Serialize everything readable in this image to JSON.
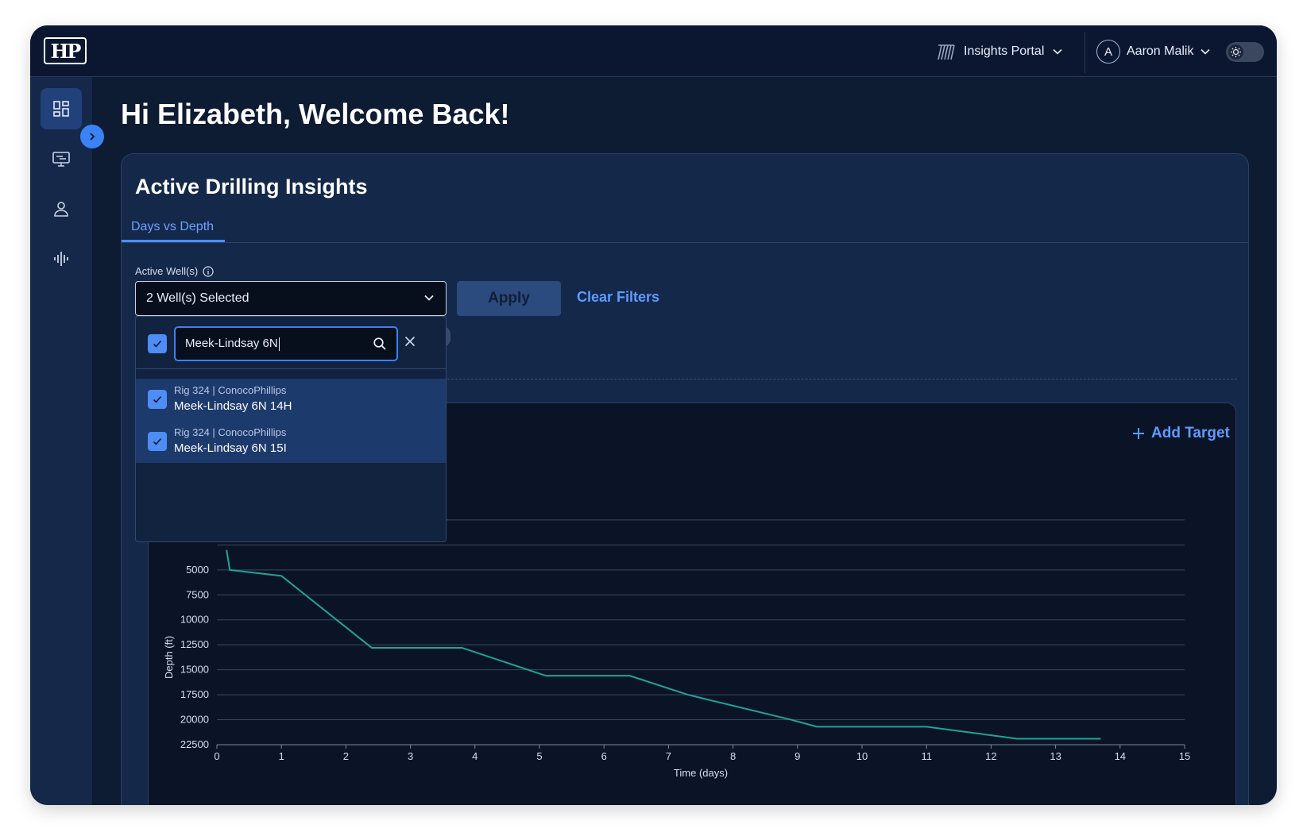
{
  "header": {
    "logo_text": "HP",
    "portal_label": "Insights Portal",
    "user_initial": "A",
    "user_name": "Aaron Malik"
  },
  "sidebar": {
    "items": [
      {
        "icon": "dashboard-icon",
        "active": true
      },
      {
        "icon": "monitor-icon",
        "active": false
      },
      {
        "icon": "user-icon",
        "active": false
      },
      {
        "icon": "waveform-icon",
        "active": false
      }
    ]
  },
  "greeting": "Hi Elizabeth, Welcome Back!",
  "card": {
    "title": "Active Drilling Insights",
    "tabs": [
      {
        "label": "Days vs Depth",
        "active": true
      }
    ],
    "filter": {
      "label": "Active Well(s)",
      "selected_value": "2 Well(s) Selected",
      "apply_label": "Apply",
      "clear_label": "Clear Filters"
    },
    "dropdown": {
      "search_value": "Meek-Lindsay 6N",
      "options": [
        {
          "rig": "Rig 324",
          "operator": "ConocoPhillips",
          "well": "Meek-Lindsay 6N 14H",
          "checked": true
        },
        {
          "rig": "Rig 324",
          "operator": "ConocoPhillips",
          "well": "Meek-Lindsay 6N 15I",
          "checked": true
        }
      ]
    },
    "add_target_label": "Add Target"
  },
  "colors": {
    "accent": "#3b82f6",
    "link": "#5f9bff",
    "series": "#1fa596",
    "background": "#0d1b33"
  },
  "chart_data": {
    "type": "line",
    "xlabel": "Time (days)",
    "ylabel": "Depth (ft)",
    "x_ticks": [
      0,
      1,
      2,
      3,
      4,
      5,
      6,
      7,
      8,
      9,
      10,
      11,
      12,
      13,
      14,
      15
    ],
    "y_ticks": [
      5000,
      7500,
      10000,
      12500,
      15000,
      17500,
      20000,
      22500
    ],
    "xlim": [
      0,
      15
    ],
    "ylim": [
      -5000,
      22500
    ],
    "y_inverted": true,
    "grid": true,
    "series": [
      {
        "x": [
          0.15,
          0.2,
          1.0,
          2.4,
          3.8,
          5.1,
          6.4,
          7.3,
          8.9,
          9.3,
          11.0,
          12.4,
          13.7
        ],
        "y": [
          3000,
          5000,
          5600,
          12800,
          12800,
          15600,
          15600,
          17500,
          20000,
          20700,
          20700,
          21900,
          21900
        ]
      }
    ]
  }
}
